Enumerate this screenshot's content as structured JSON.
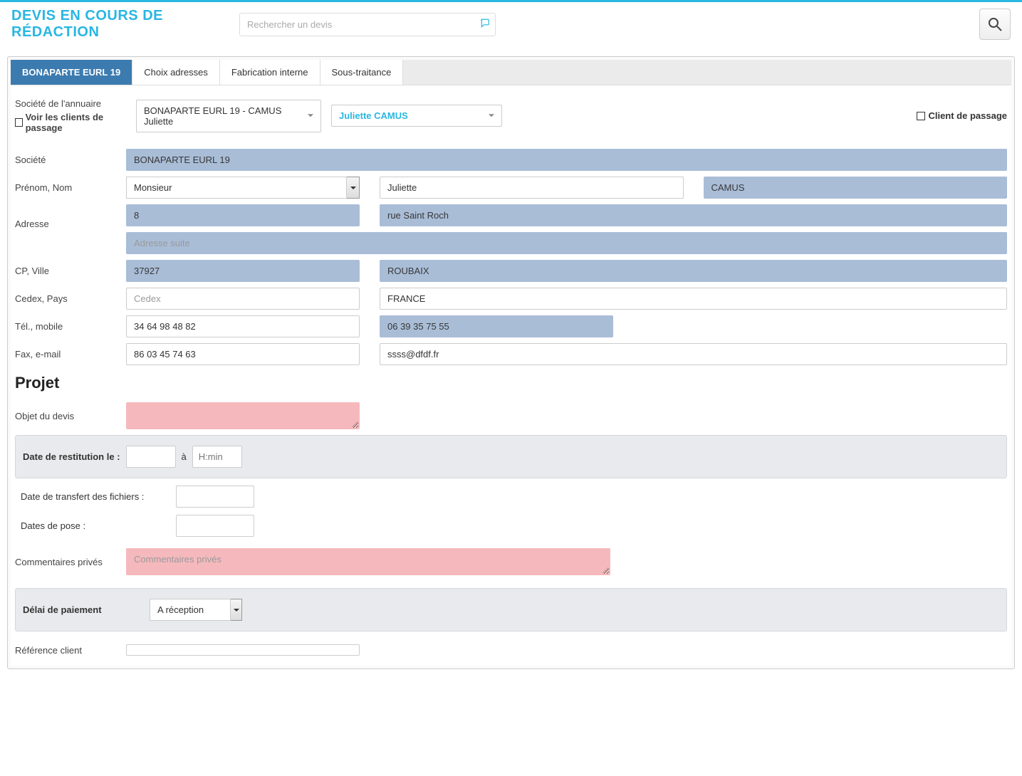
{
  "header": {
    "title": "DEVIS EN COURS DE RÉDACTION",
    "search_placeholder": "Rechercher un devis"
  },
  "tabs": [
    {
      "label": "BONAPARTE EURL 19",
      "active": true
    },
    {
      "label": "Choix adresses",
      "active": false
    },
    {
      "label": "Fabrication interne",
      "active": false
    },
    {
      "label": "Sous-traitance",
      "active": false
    }
  ],
  "societe_section": {
    "label_annuaire": "Société de l'annuaire",
    "chk_passage_clients": "Voir les clients de passage",
    "select_societe": "BONAPARTE EURL 19 - CAMUS Juliette",
    "select_contact": "Juliette CAMUS",
    "chk_client_passage": "Client de passage"
  },
  "labels": {
    "societe": "Société",
    "prenom_nom": "Prénom, Nom",
    "adresse": "Adresse",
    "cp_ville": "CP, Ville",
    "cedex_pays": "Cedex, Pays",
    "tel_mobile": "Tél., mobile",
    "fax_email": "Fax, e-mail"
  },
  "values": {
    "societe": "BONAPARTE EURL 19",
    "civilite": "Monsieur",
    "prenom": "Juliette",
    "nom": "CAMUS",
    "adr_num": "8",
    "adr_voie": "rue Saint Roch",
    "adr_suite_placeholder": "Adresse suite",
    "cp": "37927",
    "ville": "ROUBAIX",
    "cedex_placeholder": "Cedex",
    "pays": "FRANCE",
    "tel": "34 64 98 48 82",
    "mobile": "06 39 35 75 55",
    "fax": "86 03 45 74 63",
    "email": "ssss@dfdf.fr"
  },
  "projet": {
    "title": "Projet",
    "label_objet": "Objet du devis",
    "label_restitution": "Date de restitution le :",
    "restitution_a": "à",
    "restitution_time_placeholder": "H:min",
    "label_transfert": "Date de transfert des fichiers :",
    "label_pose": "Dates de pose :",
    "label_commentaires": "Commentaires privés",
    "commentaires_placeholder": "Commentaires privés",
    "label_delai": "Délai de paiement",
    "delai_value": "A réception",
    "label_ref": "Référence client"
  }
}
